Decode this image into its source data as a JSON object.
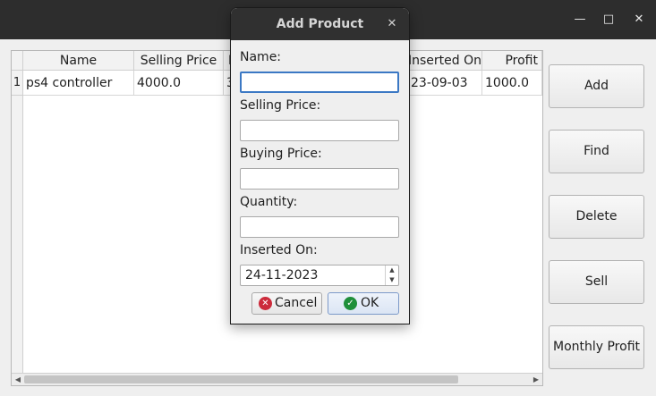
{
  "main": {
    "table": {
      "columns": [
        "Name",
        "Selling Price",
        "Bu",
        "Inserted On",
        "Profit"
      ],
      "rows": [
        {
          "number": "1",
          "cells": [
            "ps4 controller",
            "4000.0",
            "30",
            "23-09-03",
            "1000.0"
          ]
        }
      ]
    },
    "buttons": {
      "add": "Add",
      "find": "Find",
      "delete": "Delete",
      "sell": "Sell",
      "monthly_profit": "Monthly Profit"
    }
  },
  "dialog": {
    "title": "Add Product",
    "fields": {
      "name_label": "Name:",
      "name_value": "",
      "selling_price_label": "Selling Price:",
      "selling_price_value": "",
      "buying_price_label": "Buying Price:",
      "buying_price_value": "",
      "quantity_label": "Quantity:",
      "quantity_value": "",
      "inserted_on_label": "Inserted On:",
      "inserted_on_value": "24-11-2023"
    },
    "buttons": {
      "cancel": "Cancel",
      "ok": "OK"
    }
  },
  "icons": {
    "window_minimize": "minimize-icon",
    "window_maximize": "maximize-icon",
    "window_close": "close-icon",
    "dialog_close": "close-icon",
    "cancel": "cancel-circle-icon",
    "ok": "check-circle-icon"
  },
  "colors": {
    "titlebar": "#2d2d2d",
    "focus_border": "#3b78c4",
    "cancel_icon": "#cc2b3b",
    "ok_icon": "#1f8f3a"
  }
}
